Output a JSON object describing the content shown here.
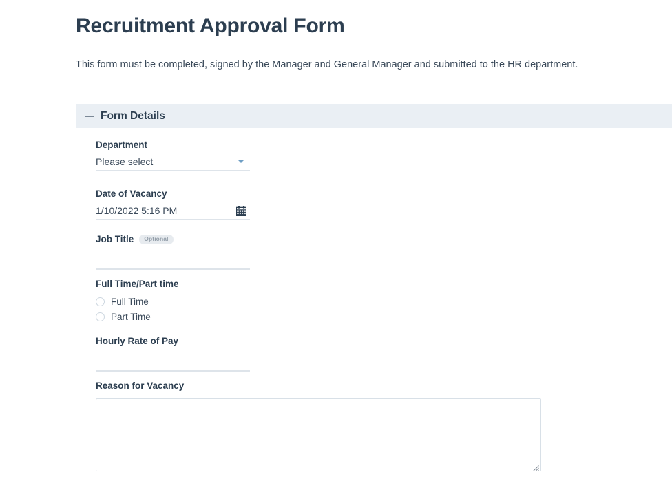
{
  "header": {
    "title": "Recruitment Approval Form",
    "description": "This form must be completed, signed by the Manager and General Manager and submitted to the HR department."
  },
  "section": {
    "title": "Form Details",
    "collapse_icon": "minus-icon",
    "background_color": "#eaeff4"
  },
  "fields": {
    "department": {
      "label": "Department",
      "value": "Please select",
      "placeholder": "Please select",
      "control": "dropdown",
      "icon": "chevron-down-icon",
      "accent_color": "#6e9ec4"
    },
    "date_of_vacancy": {
      "label": "Date of Vacancy",
      "value": "1/10/2022 5:16 PM",
      "control": "datetime",
      "icon": "calendar-icon"
    },
    "job_title": {
      "label": "Job Title",
      "badge": "Optional",
      "value": "",
      "control": "text"
    },
    "full_time_part_time": {
      "label": "Full Time/Part time",
      "control": "radio",
      "options": [
        {
          "label": "Full Time",
          "selected": false
        },
        {
          "label": "Part Time",
          "selected": false
        }
      ]
    },
    "hourly_rate": {
      "label": "Hourly Rate of Pay",
      "value": "",
      "control": "text"
    },
    "reason_for_vacancy": {
      "label": "Reason for Vacancy",
      "value": "",
      "control": "textarea"
    }
  }
}
